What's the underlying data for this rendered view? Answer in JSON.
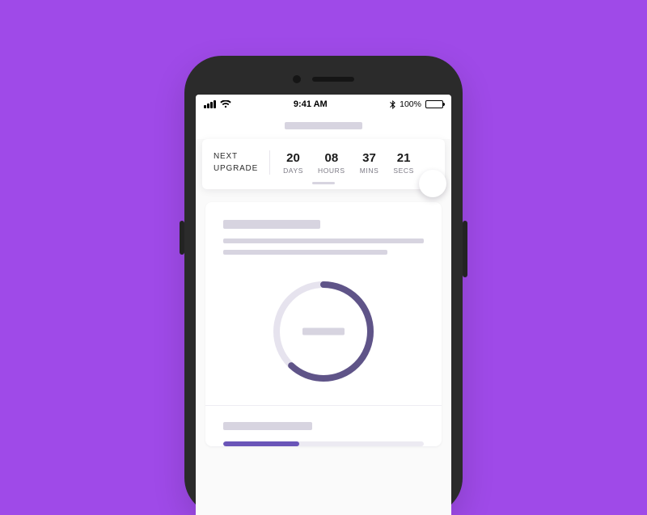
{
  "status_bar": {
    "time": "9:41 AM",
    "battery_label": "100%",
    "battery_percent": 100
  },
  "countdown": {
    "label": "NEXT\nUPGRADE",
    "units": [
      {
        "value": "20",
        "label": "DAYS"
      },
      {
        "value": "08",
        "label": "HOURS"
      },
      {
        "value": "37",
        "label": "MINS"
      },
      {
        "value": "21",
        "label": "SECS"
      }
    ]
  },
  "ring": {
    "percent": 62
  },
  "progress_bar": {
    "percent": 38
  },
  "colors": {
    "background": "#9f4ae8",
    "accent_deep": "#5f5488",
    "accent": "#6a55b8",
    "placeholder": "#d7d4e0"
  }
}
